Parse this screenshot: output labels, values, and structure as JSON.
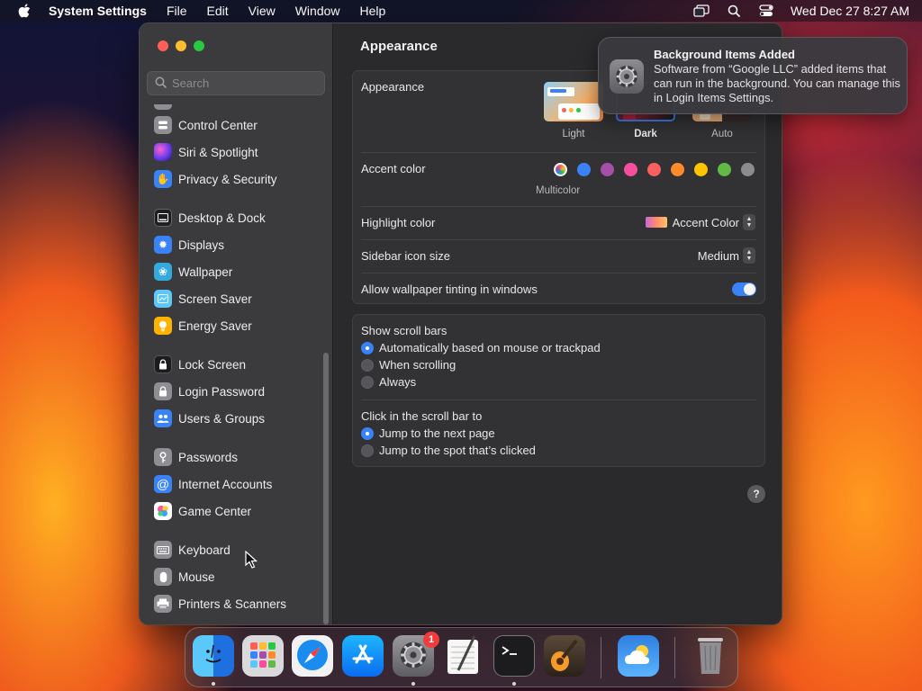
{
  "menubar": {
    "app_name": "System Settings",
    "menus": [
      "File",
      "Edit",
      "View",
      "Window",
      "Help"
    ],
    "clock": "Wed Dec 27  8:27 AM"
  },
  "sidebar": {
    "search_placeholder": "Search",
    "items": [
      {
        "label": "Control Center",
        "icon": "control-center-icon",
        "color": "#8e8e93"
      },
      {
        "label": "Siri & Spotlight",
        "icon": "siri-icon",
        "color": "#b44fd6"
      },
      {
        "label": "Privacy & Security",
        "icon": "hand-icon",
        "color": "#3a82f7"
      },
      {
        "label": "Desktop & Dock",
        "icon": "dock-icon",
        "color": "#2c2c2e"
      },
      {
        "label": "Displays",
        "icon": "sun-icon",
        "color": "#3a82f7"
      },
      {
        "label": "Wallpaper",
        "icon": "flower-icon",
        "color": "#34aadc"
      },
      {
        "label": "Screen Saver",
        "icon": "screen-saver-icon",
        "color": "#5ac8fa"
      },
      {
        "label": "Energy Saver",
        "icon": "lightbulb-icon",
        "color": "#ffb300"
      },
      {
        "label": "Lock Screen",
        "icon": "lock-icon",
        "color": "#1c1c1e"
      },
      {
        "label": "Login Password",
        "icon": "lock-icon",
        "color": "#8e8e93"
      },
      {
        "label": "Users & Groups",
        "icon": "users-icon",
        "color": "#3a82f7"
      },
      {
        "label": "Passwords",
        "icon": "key-icon",
        "color": "#8e8e93"
      },
      {
        "label": "Internet Accounts",
        "icon": "at-icon",
        "color": "#3a82f7"
      },
      {
        "label": "Game Center",
        "icon": "game-center-icon",
        "color": "#ffffff"
      },
      {
        "label": "Keyboard",
        "icon": "keyboard-icon",
        "color": "#8e8e93"
      },
      {
        "label": "Mouse",
        "icon": "mouse-icon",
        "color": "#8e8e93"
      },
      {
        "label": "Printers & Scanners",
        "icon": "printer-icon",
        "color": "#8e8e93"
      }
    ]
  },
  "main": {
    "title": "Appearance",
    "appearance": {
      "label": "Appearance",
      "options": [
        "Light",
        "Dark",
        "Auto"
      ],
      "selected": "Dark"
    },
    "accent": {
      "label": "Accent color",
      "caption": "Multicolor",
      "colors": [
        "#3a82f7",
        "#a550a7",
        "#f74f9e",
        "#fc5f5f",
        "#fd8a2b",
        "#ffc600",
        "#62ba46",
        "#8c8c8c"
      ]
    },
    "highlight": {
      "label": "Highlight color",
      "value": "Accent Color"
    },
    "icon_size": {
      "label": "Sidebar icon size",
      "value": "Medium"
    },
    "tinting": {
      "label": "Allow wallpaper tinting in windows",
      "on": true
    },
    "scroll_bars": {
      "label": "Show scroll bars",
      "options": [
        "Automatically based on mouse or trackpad",
        "When scrolling",
        "Always"
      ],
      "selected": "Automatically based on mouse or trackpad"
    },
    "click_scroll": {
      "label": "Click in the scroll bar to",
      "options": [
        "Jump to the next page",
        "Jump to the spot that’s clicked"
      ],
      "selected": "Jump to the next page"
    },
    "help_label": "?"
  },
  "notification": {
    "title": "Background Items Added",
    "body": "Software from “Google LLC” added items that can run in the background. You can manage this in Login Items Settings."
  },
  "dock": {
    "apps": [
      "Finder",
      "Launchpad",
      "Safari",
      "App Store",
      "System Settings",
      "TextEdit",
      "Terminal",
      "GarageBand",
      "Weather",
      "Trash"
    ],
    "badge": "1"
  }
}
